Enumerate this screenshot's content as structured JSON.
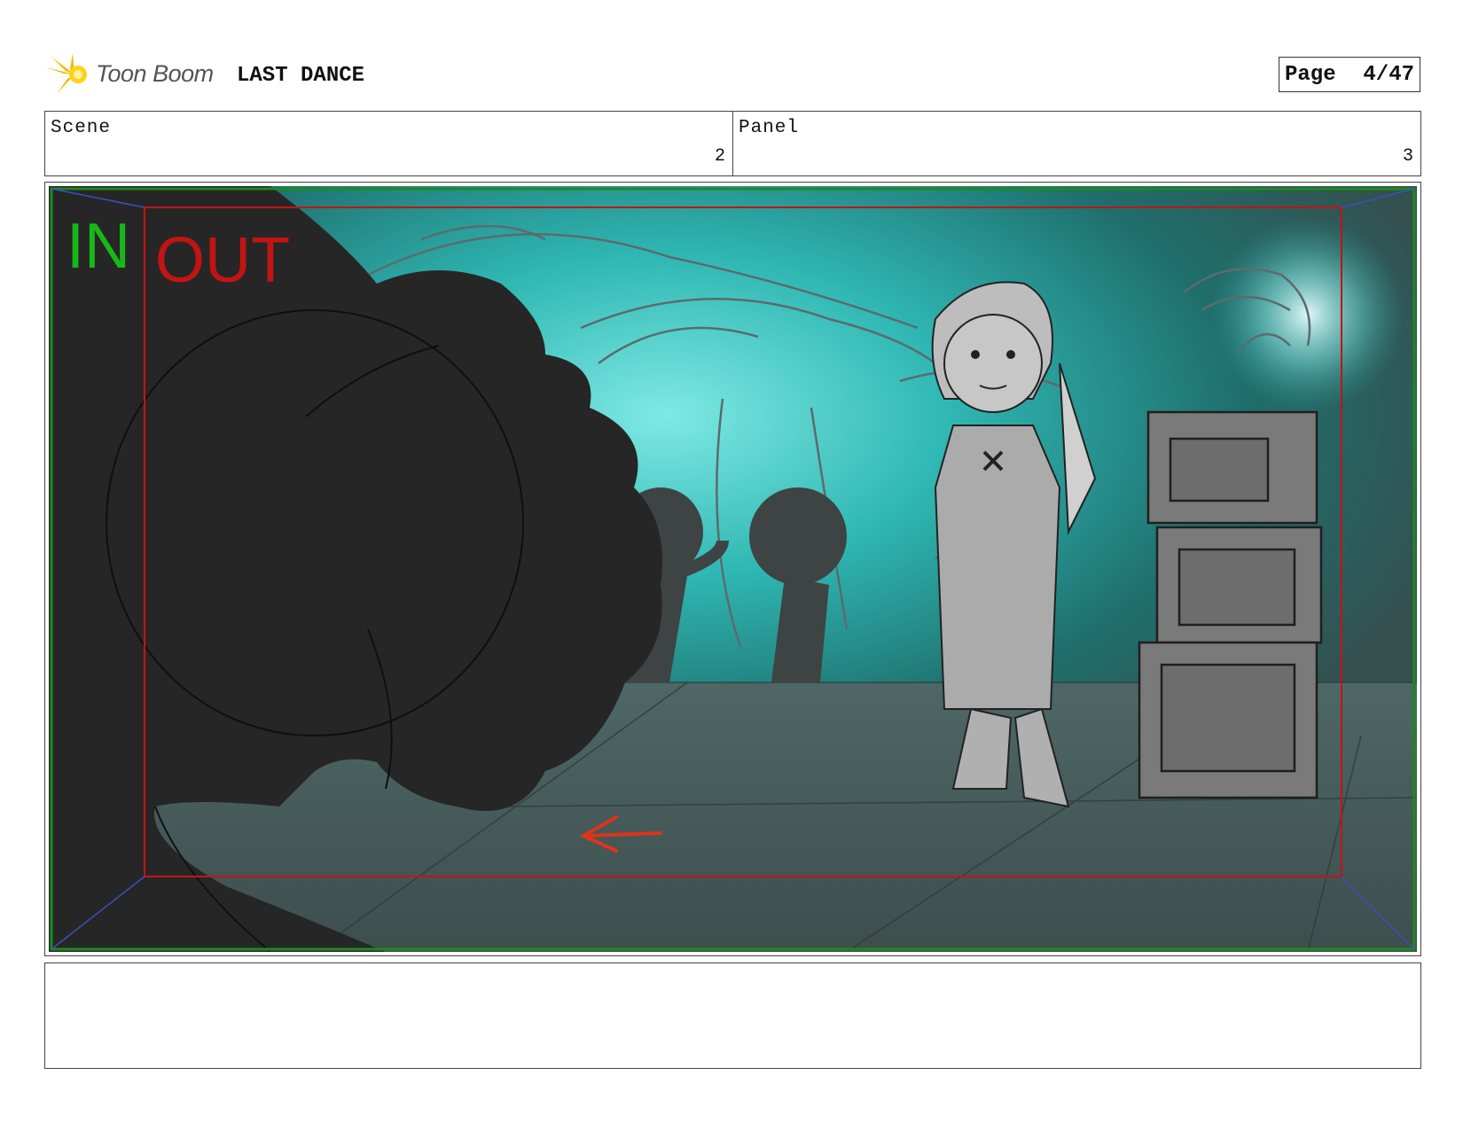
{
  "header": {
    "app_logo_text": "Toon Boom",
    "project_title": "LAST DANCE",
    "page_label": "Page",
    "page_value": "4/47"
  },
  "info": {
    "scene_label": "Scene",
    "scene_value": "2",
    "panel_label": "Panel",
    "panel_value": "3"
  },
  "panel": {
    "in_label": "IN",
    "out_label": "OUT",
    "in_frame_color": "#1d8a1d",
    "out_frame_color": "#c21414",
    "camera_direction": "left"
  },
  "notes": {
    "text": ""
  }
}
